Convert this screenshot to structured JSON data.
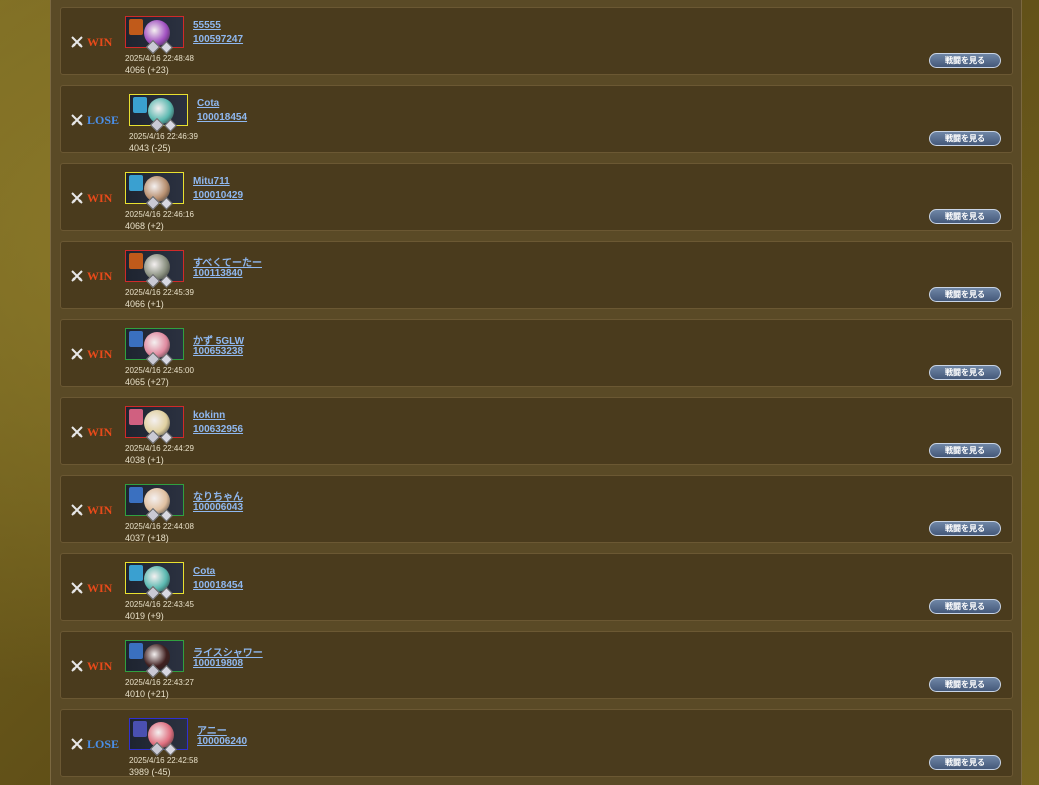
{
  "colors": {
    "win": "#e84a1a",
    "lose": "#4a8fe8",
    "link": "#8fb8f0",
    "row_bg": "#4a3b1d"
  },
  "watch_label": "戦闘を見る",
  "battles": [
    {
      "result": "WIN",
      "name": "55555",
      "id": "100597247",
      "datetime": "2025/4/16 22:48:48",
      "score": "4066 (+23)",
      "frame": "#d02a2a",
      "badge": "#c05a1a",
      "face": "#a050c0"
    },
    {
      "result": "LOSE",
      "name": "Cota",
      "id": "100018454",
      "datetime": "2025/4/16 22:46:39",
      "score": "4043 (-25)",
      "frame": "#e8e030",
      "badge": "#3aa0d0",
      "face": "#5ab8b0"
    },
    {
      "result": "WIN",
      "name": "Mitu711",
      "id": "100010429",
      "datetime": "2025/4/16 22:46:16",
      "score": "4068 (+2)",
      "frame": "#e8e030",
      "badge": "#3aa0d0",
      "face": "#b89070"
    },
    {
      "result": "WIN",
      "name": "すべくてーたー",
      "id": "100113840",
      "datetime": "2025/4/16 22:45:39",
      "score": "4066 (+1)",
      "frame": "#d02a2a",
      "badge": "#c05a1a",
      "face": "#8a9080"
    },
    {
      "result": "WIN",
      "name": "かず 5GLW",
      "id": "100653238",
      "datetime": "2025/4/16 22:45:00",
      "score": "4065 (+27)",
      "frame": "#30a040",
      "badge": "#3a70c0",
      "face": "#e08aa0"
    },
    {
      "result": "WIN",
      "name": "kokinn",
      "id": "100632956",
      "datetime": "2025/4/16 22:44:29",
      "score": "4038 (+1)",
      "frame": "#d02a2a",
      "badge": "#d06080",
      "face": "#e0d0a0"
    },
    {
      "result": "WIN",
      "name": "なりちゃん",
      "id": "100006043",
      "datetime": "2025/4/16 22:44:08",
      "score": "4037 (+18)",
      "frame": "#30a040",
      "badge": "#3a70c0",
      "face": "#e0c0a0"
    },
    {
      "result": "WIN",
      "name": "Cota",
      "id": "100018454",
      "datetime": "2025/4/16 22:43:45",
      "score": "4019 (+9)",
      "frame": "#e8e030",
      "badge": "#3aa0d0",
      "face": "#5ab8b0"
    },
    {
      "result": "WIN",
      "name": "ライスシャワー",
      "id": "100019808",
      "datetime": "2025/4/16 22:43:27",
      "score": "4010 (+21)",
      "frame": "#30a040",
      "badge": "#3a70c0",
      "face": "#402020"
    },
    {
      "result": "LOSE",
      "name": "アニー",
      "id": "100006240",
      "datetime": "2025/4/16 22:42:58",
      "score": "3989 (-45)",
      "frame": "#3030d0",
      "badge": "#4a50b0",
      "face": "#e07080"
    }
  ]
}
